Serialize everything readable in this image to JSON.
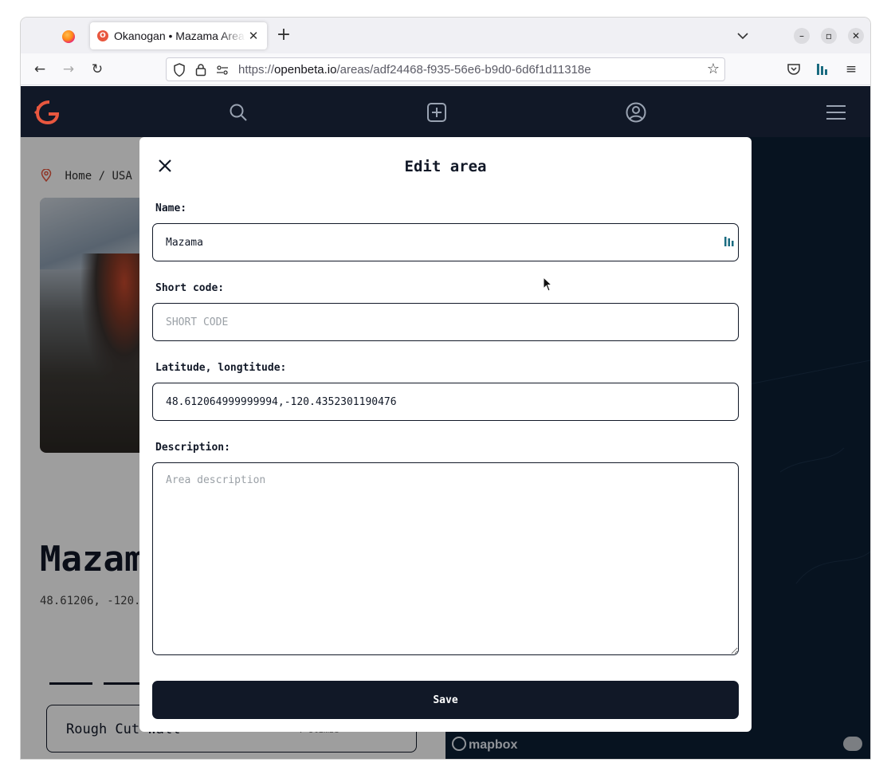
{
  "browser": {
    "tab": {
      "title": "Okanogan • Mazama Area",
      "favicon_letter": "O"
    },
    "url": {
      "scheme_prefix": "https://",
      "host": "openbeta.io",
      "path": "/areas/adf24468-f935-56e6-b9d0-6d6f1d11318e"
    }
  },
  "site": {
    "breadcrumb": [
      "Home",
      "USA"
    ],
    "breadcrumb_separator": "/",
    "area_title": "Mazam",
    "coords": "48.61206, -120.",
    "climb_card": {
      "name": "Rough Cut Wall",
      "count": "4 climbs"
    },
    "map": {
      "attribution": "mapbox"
    }
  },
  "modal": {
    "title": "Edit area",
    "name": {
      "label": "Name:",
      "value": "Mazama"
    },
    "short_code": {
      "label": "Short code:",
      "placeholder": "SHORT CODE",
      "value": ""
    },
    "latlng": {
      "label": "Latitude, longtitude:",
      "value": "48.612064999999994,-120.4352301190476"
    },
    "description": {
      "label": "Description:",
      "placeholder": "Area description",
      "value": ""
    },
    "save_label": "Save"
  },
  "colors": {
    "header_bg": "#111827",
    "brand_accent": "#e8573f",
    "map_bg": "#0c1f35",
    "primary_button": "#111827"
  }
}
